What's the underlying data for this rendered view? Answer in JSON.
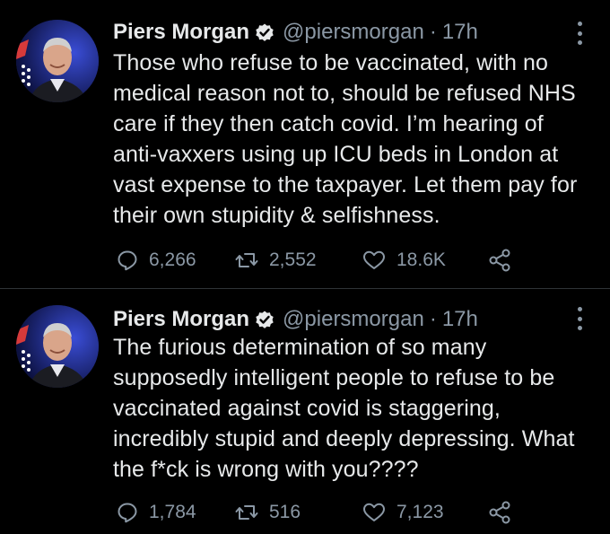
{
  "colors": {
    "background": "#000000",
    "text": "#e7e9ea",
    "secondary_text": "#8b98a5",
    "verified": "#e7e9ea",
    "divider": "#2f3336"
  },
  "tweets": [
    {
      "author": {
        "name": "Piers Morgan",
        "handle": "@piersmorgan",
        "verified_icon": "verified-badge-icon",
        "avatar_icon": "avatar"
      },
      "separator": "·",
      "time": "17h",
      "text": "Those who refuse to be vaccinated, with no medical reason not to, should be refused NHS care if they then catch covid. I’m hearing of anti-vaxxers using up ICU beds in London at vast expense to the taxpayer. Let them pay for their own stupidity & selfishness.",
      "actions": {
        "replies": "6,266",
        "retweets": "2,552",
        "likes": "18.6K"
      }
    },
    {
      "author": {
        "name": "Piers Morgan",
        "handle": "@piersmorgan",
        "verified_icon": "verified-badge-icon",
        "avatar_icon": "avatar"
      },
      "separator": "·",
      "time": "17h",
      "text": "The furious determination of so many supposedly intelligent people to refuse to be vaccinated against covid is staggering, incredibly stupid and deeply depressing. What the f*ck is wrong with you????",
      "actions": {
        "replies": "1,784",
        "retweets": "516",
        "likes": "7,123"
      }
    }
  ]
}
